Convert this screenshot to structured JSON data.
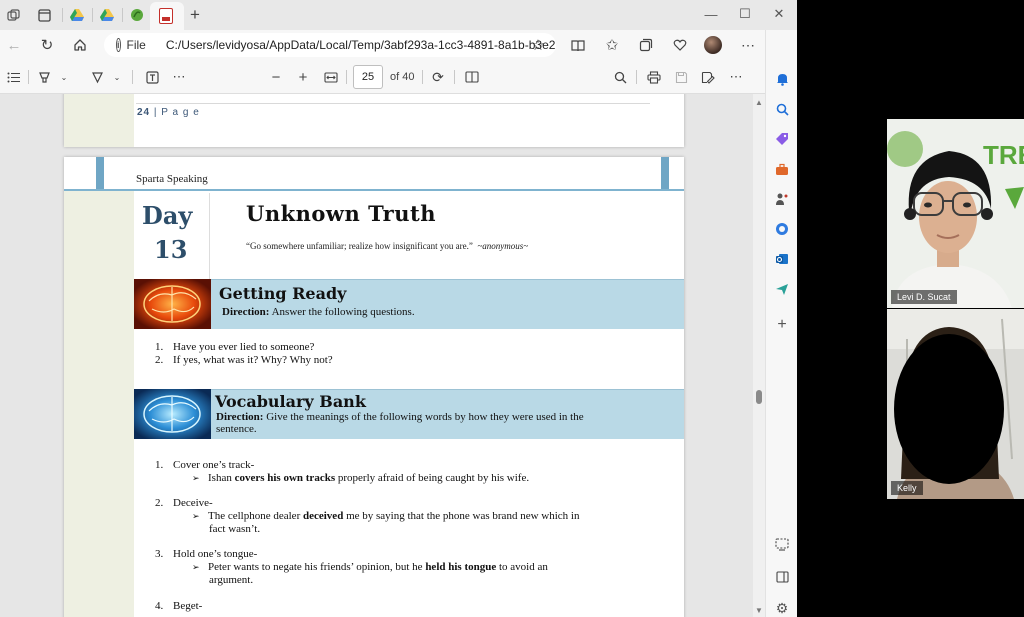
{
  "browser": {
    "address": {
      "scheme_label": "File",
      "url": "C:/Users/levidyosa/AppData/Local/Temp/3abf293a-1cc3-4891-8a1b-b3e2..."
    },
    "pdf_toolbar": {
      "current_page": "25",
      "page_total_label": "of 40"
    }
  },
  "document": {
    "prev_page": {
      "page_number": "24",
      "page_word": "P a g e"
    },
    "page": {
      "header": "Sparta Speaking",
      "day_label": "Day",
      "day_number": "13",
      "title": "Unknown Truth",
      "quote": "“Go somewhere unfamiliar; realize how insignificant you are.”",
      "quote_author": "~anonymous~",
      "getting_ready": {
        "title": "Getting Ready",
        "direction_label": "Direction:",
        "direction_text": " Answer the following questions.",
        "questions": [
          {
            "n": "1.",
            "text": "Have you ever lied to someone?"
          },
          {
            "n": "2.",
            "text": "If yes, what was it? Why? Why not?"
          }
        ]
      },
      "vocabulary": {
        "title": "Vocabulary Bank",
        "direction_label": "Direction:",
        "direction_line1": " Give the meanings of the following words by how they were used in the",
        "direction_line2": "sentence.",
        "items": [
          {
            "n": "1.",
            "term": "Cover one’s track-",
            "s_pre": "Ishan ",
            "s_bold": "covers his own tracks",
            "s_post": " properly afraid of being caught by his wife.",
            "s_line2": ""
          },
          {
            "n": "2.",
            "term": "Deceive-",
            "s_pre": "The cellphone dealer ",
            "s_bold": "deceived",
            "s_post": " me by saying that the phone was brand new which in",
            "s_line2": "fact wasn’t."
          },
          {
            "n": "3.",
            "term": "Hold one’s tongue-",
            "s_pre": "Peter wants to negate his friends’ opinion, but he ",
            "s_bold": "held his tongue",
            "s_post": " to avoid an",
            "s_line2": "argument."
          },
          {
            "n": "4.",
            "term": "Beget-"
          }
        ]
      }
    }
  },
  "video_call": {
    "participants": [
      {
        "name": "Levi D. Sucat"
      },
      {
        "name": "Kelly"
      }
    ],
    "background_text": "TRE"
  }
}
